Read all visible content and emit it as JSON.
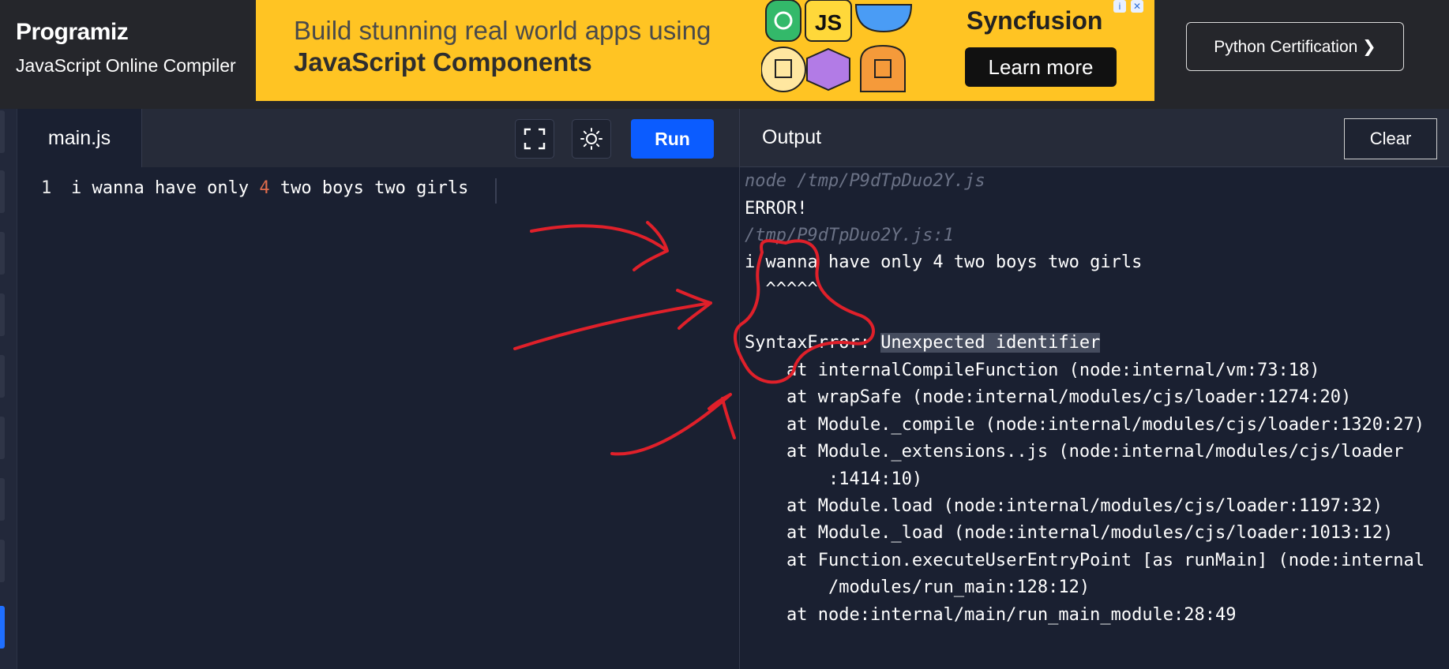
{
  "header": {
    "logo_text": "Programiz",
    "subtitle": "JavaScript Online Compiler",
    "cert_button": "Python Certification ❯"
  },
  "ad": {
    "line1": "Build stunning real world apps using",
    "line2": "JavaScript Components",
    "badge_js": "JS",
    "brand": "Syncfusion",
    "cta": "Learn more",
    "info": "i",
    "close": "✕"
  },
  "editor": {
    "tab": "main.js",
    "run_label": "Run",
    "line_number": "1",
    "code_before": "i wanna have only ",
    "code_number": "4",
    "code_after": " two boys two girls"
  },
  "output": {
    "title": "Output",
    "clear_label": "Clear",
    "lines": [
      "node /tmp/P9dTpDuo2Y.js",
      "ERROR!",
      "/tmp/P9dTpDuo2Y.js:1",
      "i wanna have only 4 two boys two girls",
      "  ^^^^^",
      "",
      "SyntaxError: ",
      "    at internalCompileFunction (node:internal/vm:73:18)",
      "    at wrapSafe (node:internal/modules/cjs/loader:1274:20)",
      "    at Module._compile (node:internal/modules/cjs/loader:1320:27)",
      "    at Module._extensions..js (node:internal/modules/cjs/loader",
      "        :1414:10)",
      "    at Module.load (node:internal/modules/cjs/loader:1197:32)",
      "    at Module._load (node:internal/modules/cjs/loader:1013:12)",
      "    at Function.executeUserEntryPoint [as runMain] (node:internal",
      "        /modules/run_main:128:12)",
      "    at node:internal/main/run_main_module:28:49"
    ],
    "error_highlight": "Unexpected identifier"
  },
  "colors": {
    "accent": "#0b5cff",
    "ad_bg": "#ffc423",
    "annotation": "#e0202a"
  }
}
